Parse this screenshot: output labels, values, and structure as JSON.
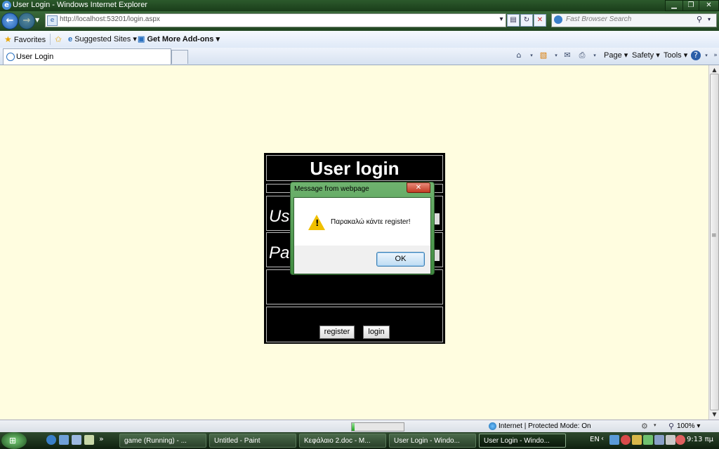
{
  "window": {
    "title": "User Login - Windows Internet Explorer"
  },
  "address": {
    "url": "http://localhost:53201/login.aspx",
    "search_placeholder": "Fast Browser Search"
  },
  "favorites": {
    "favorites_label": "Favorites",
    "suggested_label": "Suggested Sites ▾",
    "addons_label": "Get More Add-ons ▾"
  },
  "tabs": [
    {
      "label": "User Login"
    }
  ],
  "commands": {
    "page": "Page ▾",
    "safety": "Safety ▾",
    "tools": "Tools ▾"
  },
  "form": {
    "title": "User login",
    "username_label": "Us",
    "password_label": "Pa",
    "register_button": "register",
    "login_button": "login"
  },
  "dialog": {
    "title": "Message from webpage",
    "message": "Παρακαλώ κάντε register!",
    "ok_label": "OK"
  },
  "status": {
    "zone_text": "Internet | Protected Mode: On",
    "zoom": "100% ▾",
    "progress_fraction": 0.05
  },
  "taskbar": {
    "buttons": [
      "game (Running) - ...",
      "Untitled - Paint",
      "Κεφάλαιο 2.doc - M...",
      "User Login - Windo...",
      "User Login - Windo..."
    ],
    "language": "EN",
    "clock": "9:13 πμ"
  },
  "colors": {
    "page_bg": "#fffde0",
    "form_bg": "#000000",
    "chrome_green": "#2c5a2c"
  }
}
